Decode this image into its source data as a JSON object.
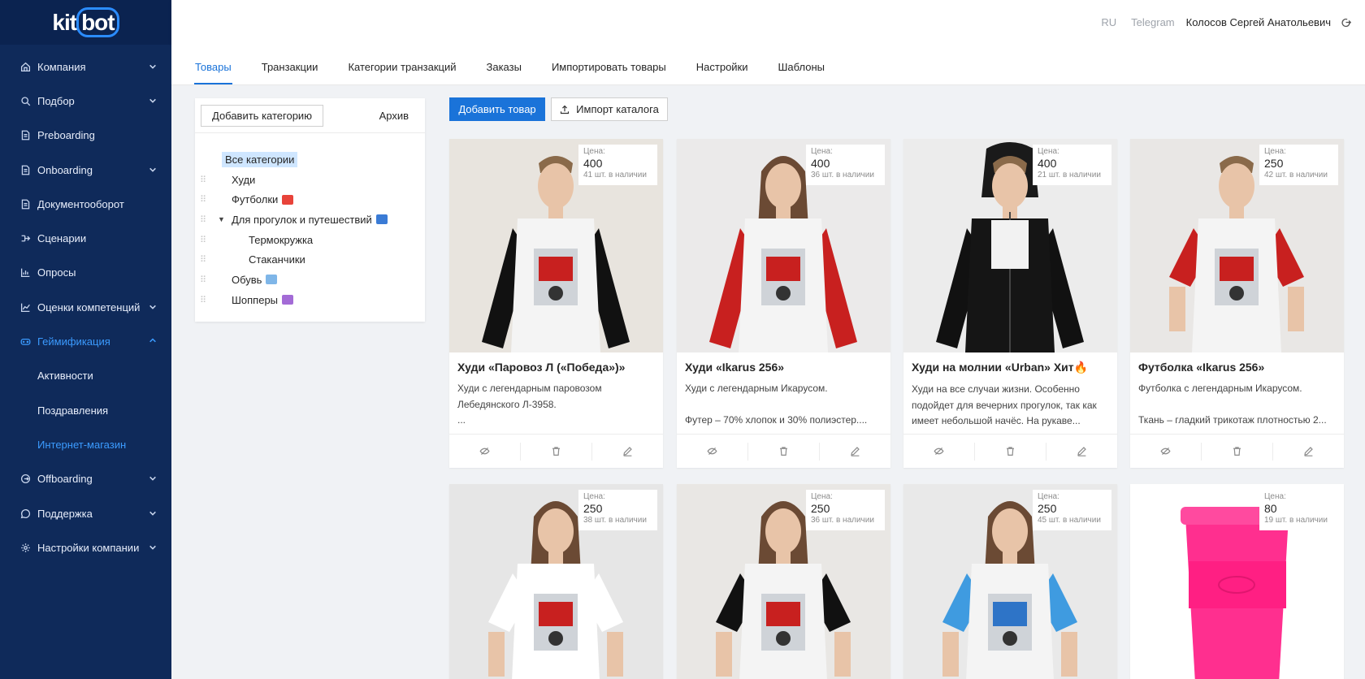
{
  "logo": {
    "text_a": "kit",
    "text_b": "bot"
  },
  "sidebar": {
    "items": [
      {
        "label": "Компания",
        "icon": "home-icon",
        "chevron": true
      },
      {
        "label": "Подбор",
        "icon": "search-icon",
        "chevron": true
      },
      {
        "label": "Preboarding",
        "icon": "doc-icon",
        "chevron": false
      },
      {
        "label": "Onboarding",
        "icon": "doc-icon",
        "chevron": true
      },
      {
        "label": "Документооборот",
        "icon": "doc-icon",
        "chevron": false
      },
      {
        "label": "Сценарии",
        "icon": "flow-icon",
        "chevron": false
      },
      {
        "label": "Опросы",
        "icon": "bar-chart-icon",
        "chevron": false
      },
      {
        "label": "Оценки компетенций",
        "icon": "line-chart-icon",
        "chevron": true
      },
      {
        "label": "Геймификация",
        "icon": "gamepad-icon",
        "chevron": true,
        "active": true
      },
      {
        "label": "Активности",
        "sub": true
      },
      {
        "label": "Поздравления",
        "sub": true
      },
      {
        "label": "Интернет-магазин",
        "sub": true,
        "current": true
      },
      {
        "label": "Offboarding",
        "icon": "exit-icon",
        "chevron": true
      },
      {
        "label": "Поддержка",
        "icon": "chat-icon",
        "chevron": true
      },
      {
        "label": "Настройки компании",
        "icon": "gear-icon",
        "chevron": true
      }
    ]
  },
  "header": {
    "lang": "RU",
    "telegram": "Telegram",
    "user": "Колосов Сергей Анатольевич"
  },
  "tabs": [
    "Товары",
    "Транзакции",
    "Категории транзакций",
    "Заказы",
    "Импортировать товары",
    "Настройки",
    "Шаблоны"
  ],
  "categories": {
    "add_label": "Добавить категорию",
    "archive_label": "Архив",
    "all_label": "Все категории",
    "tree": [
      {
        "label": "Худи",
        "level": 1
      },
      {
        "label": "Футболки",
        "level": 1,
        "emoji_color": "#e8433a"
      },
      {
        "label": "Для прогулок и путешествий",
        "level": 1,
        "caret": true,
        "emoji_color": "#3a7bd5"
      },
      {
        "label": "Термокружка",
        "level": 2
      },
      {
        "label": "Стаканчики",
        "level": 2
      },
      {
        "label": "Обувь",
        "level": 1,
        "emoji_color": "#7fb6e8"
      },
      {
        "label": "Шопперы",
        "level": 1,
        "emoji_color": "#a36bd6"
      }
    ]
  },
  "actions": {
    "add_product": "Добавить товар",
    "import_catalog": "Импорт каталога"
  },
  "price_label": "Цена:",
  "products": [
    {
      "title": "Худи «Паровоз Л («Победа»)»",
      "desc": "Худи с легендарным паровозом\nЛебедянского Л-3958.\n...",
      "price": "400",
      "stock": "41 шт. в наличии",
      "kind": "hoodie",
      "sleeve": "#111111",
      "body": "#f4f4f4",
      "bg": "#e8e4de"
    },
    {
      "title": "Худи «Ikarus 256»",
      "desc": "Худи с легендарным Икарусом.\n\nФутер – 70% хлопок и 30% полиэстер....",
      "price": "400",
      "stock": "36 шт. в наличии",
      "kind": "hoodie-girl",
      "sleeve": "#c8201f",
      "body": "#f4f4f4",
      "bg": "#ebeaea"
    },
    {
      "title": "Худи на молнии «Urban» Хит🔥",
      "desc": "Худи на все случаи жизни. Особенно\nподойдет для вечерних прогулок, так как\nимеет небольшой начёс. На рукаве...",
      "price": "400",
      "stock": "21 шт. в наличии",
      "kind": "zip",
      "sleeve": "#111111",
      "body": "#151515",
      "bg": "#ececec"
    },
    {
      "title": "Футболка «Ikarus 256»",
      "desc": "Футболка с легендарным Икарусом.\n\nТкань – гладкий трикотаж плотностью 2...",
      "price": "250",
      "stock": "42 шт. в наличии",
      "kind": "tee",
      "sleeve": "#c8201f",
      "body": "#f4f4f4",
      "bg": "#e9e7e5"
    },
    {
      "title": "",
      "desc": "",
      "price": "250",
      "stock": "38 шт. в наличии",
      "kind": "tee-girl",
      "sleeve": "#ffffff",
      "body": "#ffffff",
      "bg": "#e6e6e6"
    },
    {
      "title": "",
      "desc": "",
      "price": "250",
      "stock": "36 шт. в наличии",
      "kind": "tee-girl",
      "sleeve": "#111111",
      "body": "#f4f4f4",
      "bg": "#e9e7e4"
    },
    {
      "title": "",
      "desc": "",
      "price": "250",
      "stock": "45 шт. в наличии",
      "kind": "tee-girl",
      "sleeve": "#3f9be0",
      "body": "#f4f4f4",
      "bg": "#e9e9e9"
    },
    {
      "title": "",
      "desc": "",
      "price": "80",
      "stock": "19 шт. в наличии",
      "kind": "cup",
      "sleeve": "#ff2f8f",
      "body": "#ff2f8f",
      "bg": "#ffffff"
    }
  ]
}
